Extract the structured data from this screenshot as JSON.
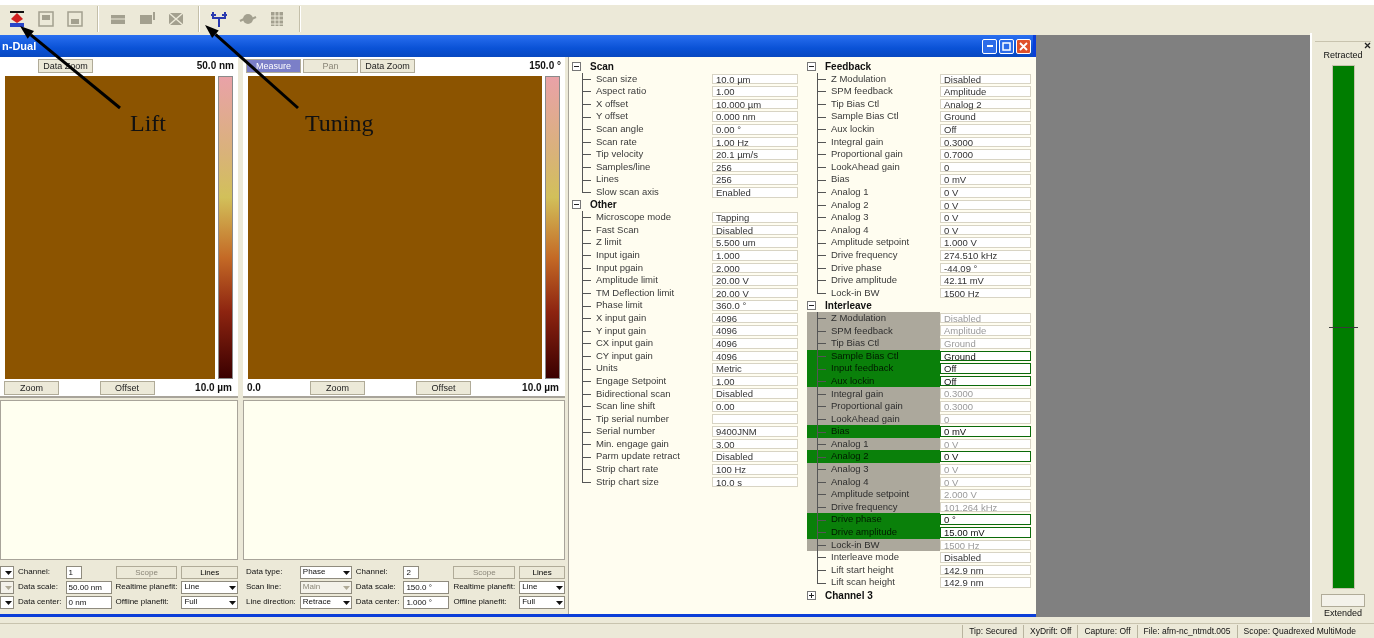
{
  "toolbar": [
    {
      "disabled": false
    },
    {
      "disabled": true
    },
    {
      "disabled": true
    },
    {
      "disabled": true
    },
    {
      "disabled": true
    },
    {
      "disabled": true
    },
    {
      "disabled": false
    },
    {
      "disabled": true
    },
    {
      "disabled": true
    }
  ],
  "annotations": [
    {
      "text": "Lift"
    },
    {
      "text": "Tuning"
    }
  ],
  "window": {
    "title": "n-Dual"
  },
  "image_panels": [
    {
      "buttons": [
        {
          "label": "Data Zoom",
          "selected": false,
          "disabled": false
        }
      ],
      "scale_max": "50.0 nm",
      "bottom_buttons": [
        "Zoom",
        "Offset"
      ],
      "axis_end": "10.0 µm",
      "controls": [
        [
          {
            "kind": "select",
            "disabled": false
          },
          {
            "kind": "field",
            "label": "Channel:",
            "value": "1"
          },
          {
            "kind": "button",
            "label": "Scope",
            "disabled": true
          },
          {
            "kind": "button",
            "label": "Lines",
            "disabled": false
          }
        ],
        [
          {
            "kind": "select",
            "disabled": true
          },
          {
            "kind": "field",
            "label": "Data scale:",
            "value": "50.00 nm"
          },
          {
            "kind": "select",
            "label": "Realtime planefit:",
            "value": "Line",
            "disabled": false
          }
        ],
        [
          {
            "kind": "select",
            "disabled": false
          },
          {
            "kind": "field",
            "label": "Data center:",
            "value": "0 nm"
          },
          {
            "kind": "select",
            "label": "Offline planefit:",
            "value": "Full",
            "disabled": false
          }
        ]
      ]
    },
    {
      "buttons": [
        {
          "label": "Measure",
          "selected": true,
          "disabled": false
        },
        {
          "label": "Pan",
          "selected": false,
          "disabled": true
        },
        {
          "label": "Data Zoom",
          "selected": false,
          "disabled": false
        }
      ],
      "scale_max": "150.0 °",
      "axis_start": "0.0",
      "bottom_buttons": [
        "Zoom",
        "Offset"
      ],
      "axis_end": "10.0 µm",
      "controls": [
        [
          {
            "kind": "select",
            "label": "Data type:",
            "value": "Phase",
            "disabled": false
          },
          {
            "kind": "field",
            "label": "Channel:",
            "value": "2"
          },
          {
            "kind": "button",
            "label": "Scope",
            "disabled": true
          },
          {
            "kind": "button",
            "label": "Lines",
            "disabled": false
          }
        ],
        [
          {
            "kind": "select",
            "label": "Scan line:",
            "value": "Main",
            "disabled": true
          },
          {
            "kind": "field",
            "label": "Data scale:",
            "value": "150.0 °"
          },
          {
            "kind": "select",
            "label": "Realtime planefit:",
            "value": "Line",
            "disabled": false
          }
        ],
        [
          {
            "kind": "select",
            "label": "Line direction:",
            "value": "Retrace",
            "disabled": false
          },
          {
            "kind": "field",
            "label": "Data center:",
            "value": "1.000 °"
          },
          {
            "kind": "select",
            "label": "Offline planefit:",
            "value": "Full",
            "disabled": false
          }
        ]
      ]
    }
  ],
  "parameter_columns": [
    {
      "groups": [
        {
          "title": "Scan",
          "expanded": true,
          "rows": [
            {
              "label": "Scan size",
              "value": "10.0 µm"
            },
            {
              "label": "Aspect ratio",
              "value": "1.00"
            },
            {
              "label": "X offset",
              "value": "10.000 µm"
            },
            {
              "label": "Y offset",
              "value": "0.000 nm"
            },
            {
              "label": "Scan angle",
              "value": "0.00 °"
            },
            {
              "label": "Scan rate",
              "value": "1.00 Hz"
            },
            {
              "label": "Tip velocity",
              "value": "20.1 µm/s"
            },
            {
              "label": "Samples/line",
              "value": "256"
            },
            {
              "label": "Lines",
              "value": "256"
            },
            {
              "label": "Slow scan axis",
              "value": "Enabled"
            }
          ]
        },
        {
          "title": "Other",
          "expanded": true,
          "rows": [
            {
              "label": "Microscope mode",
              "value": "Tapping"
            },
            {
              "label": "Fast Scan",
              "value": "Disabled"
            },
            {
              "label": "Z limit",
              "value": "5.500 um"
            },
            {
              "label": "Input igain",
              "value": "1.000"
            },
            {
              "label": "Input pgain",
              "value": "2.000"
            },
            {
              "label": "Amplitude limit",
              "value": "20.00 V"
            },
            {
              "label": "TM Deflection limit",
              "value": "20.00 V"
            },
            {
              "label": "Phase limit",
              "value": "360.0 °"
            },
            {
              "label": "X input gain",
              "value": "4096"
            },
            {
              "label": "Y input gain",
              "value": "4096"
            },
            {
              "label": "CX input gain",
              "value": "4096"
            },
            {
              "label": "CY input gain",
              "value": "4096"
            },
            {
              "label": "Units",
              "value": "Metric"
            },
            {
              "label": "Engage Setpoint",
              "value": "1.00"
            },
            {
              "label": "Bidirectional scan",
              "value": "Disabled"
            },
            {
              "label": "Scan line shift",
              "value": "0.00"
            },
            {
              "label": "Tip serial number"
            },
            {
              "label": "Serial number",
              "value": "9400JNM"
            },
            {
              "label": "Min. engage gain",
              "value": "3.00"
            },
            {
              "label": "Parm update retract",
              "value": "Disabled"
            },
            {
              "label": "Strip chart rate",
              "value": "100 Hz"
            },
            {
              "label": "Strip chart size",
              "value": "10.0 s"
            }
          ]
        }
      ]
    },
    {
      "groups": [
        {
          "title": "Feedback",
          "expanded": true,
          "rows": [
            {
              "label": "Z Modulation",
              "value": "Disabled"
            },
            {
              "label": "SPM feedback",
              "value": "Amplitude"
            },
            {
              "label": "Tip Bias Ctl",
              "value": "Analog 2"
            },
            {
              "label": "Sample Bias Ctl",
              "value": "Ground"
            },
            {
              "label": "Aux lockin",
              "value": "Off"
            },
            {
              "label": "Integral gain",
              "value": "0.3000"
            },
            {
              "label": "Proportional gain",
              "value": "0.7000"
            },
            {
              "label": "LookAhead gain",
              "value": "0"
            },
            {
              "label": "Bias",
              "value": "0 mV"
            },
            {
              "label": "Analog 1",
              "value": "0 V"
            },
            {
              "label": "Analog 2",
              "value": "0 V"
            },
            {
              "label": "Analog 3",
              "value": "0 V"
            },
            {
              "label": "Analog 4",
              "value": "0 V"
            },
            {
              "label": "Amplitude setpoint",
              "value": "1.000 V"
            },
            {
              "label": "Drive frequency",
              "value": "274.510 kHz"
            },
            {
              "label": "Drive phase",
              "value": "-44.09 °"
            },
            {
              "label": "Drive amplitude",
              "value": "42.11 mV"
            },
            {
              "label": "Lock-in BW",
              "value": "1500 Hz"
            }
          ]
        },
        {
          "title": "Interleave",
          "expanded": true,
          "rows": [
            {
              "label": "Z Modulation",
              "value": "Disabled",
              "kind": "dimmed"
            },
            {
              "label": "SPM feedback",
              "value": "Amplitude",
              "kind": "dimmed"
            },
            {
              "label": "Tip Bias Ctl",
              "value": "Ground",
              "kind": "dimmed"
            },
            {
              "label": "Sample Bias Ctl",
              "value": "Ground",
              "kind": "active"
            },
            {
              "label": "Input feedback",
              "value": "Off",
              "kind": "active"
            },
            {
              "label": "Aux lockin",
              "value": "Off",
              "kind": "active"
            },
            {
              "label": "Integral gain",
              "value": "0.3000",
              "kind": "dimmed"
            },
            {
              "label": "Proportional gain",
              "value": "0.3000",
              "kind": "dimmed"
            },
            {
              "label": "LookAhead gain",
              "value": "0",
              "kind": "dimmed"
            },
            {
              "label": "Bias",
              "value": "0 mV",
              "kind": "active"
            },
            {
              "label": "Analog 1",
              "value": "0 V",
              "kind": "dimmed"
            },
            {
              "label": "Analog 2",
              "value": "0 V",
              "kind": "active"
            },
            {
              "label": "Analog 3",
              "value": "0 V",
              "kind": "dimmed"
            },
            {
              "label": "Analog 4",
              "value": "0 V",
              "kind": "dimmed"
            },
            {
              "label": "Amplitude setpoint",
              "value": "2.000 V",
              "kind": "dimmed"
            },
            {
              "label": "Drive frequency",
              "value": "101.264 kHz",
              "kind": "dimmed"
            },
            {
              "label": "Drive phase",
              "value": "0 °",
              "kind": "active"
            },
            {
              "label": "Drive amplitude",
              "value": "15.00 mV",
              "kind": "active"
            },
            {
              "label": "Lock-in BW",
              "value": "1500 Hz",
              "kind": "dimmed"
            },
            {
              "label": "Interleave mode",
              "value": "Disabled",
              "kind": "plain"
            },
            {
              "label": "Lift start height",
              "value": "142.9 nm",
              "kind": "plain"
            },
            {
              "label": "Lift scan height",
              "value": "142.9 nm",
              "kind": "plain"
            }
          ]
        },
        {
          "title": "Channel 3",
          "expanded": false
        }
      ]
    }
  ],
  "meter": {
    "top_label": "Retracted",
    "bottom_label": "Extended",
    "level": 0.5
  },
  "status_bar": [
    "Tip: Secured",
    "XyDrift: Off",
    "Capture: Off",
    "File: afm-nc_ntmdt.005",
    "Scope: Quadrexed MultiMode"
  ]
}
